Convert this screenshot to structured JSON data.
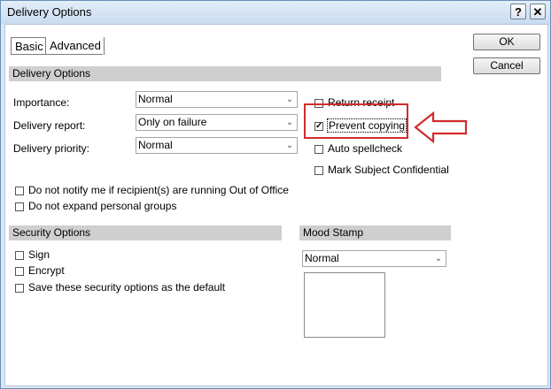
{
  "window": {
    "title": "Delivery Options",
    "help_glyph": "?",
    "close_glyph": "✕"
  },
  "tabs": [
    {
      "label": "Basic"
    },
    {
      "label": "Advanced"
    }
  ],
  "buttons": {
    "ok": "OK",
    "cancel": "Cancel"
  },
  "delivery": {
    "header": "Delivery Options",
    "importance": {
      "label": "Importance:",
      "value": "Normal"
    },
    "report": {
      "label": "Delivery report:",
      "value": "Only on failure"
    },
    "priority": {
      "label": "Delivery priority:",
      "value": "Normal"
    },
    "checkboxes": [
      {
        "label": "Return receipt",
        "checked": false
      },
      {
        "label": "Prevent copying",
        "checked": true
      },
      {
        "label": "Auto spellcheck",
        "checked": false
      },
      {
        "label": "Mark Subject Confidential",
        "checked": false
      }
    ],
    "options": [
      {
        "label": "Do not notify me if recipient(s) are running Out of Office",
        "checked": false
      },
      {
        "label": "Do not expand personal groups",
        "checked": false
      }
    ]
  },
  "security": {
    "header": "Security Options",
    "checkboxes": [
      {
        "label": "Sign",
        "checked": false
      },
      {
        "label": "Encrypt",
        "checked": false
      },
      {
        "label": "Save these security options as the default",
        "checked": false
      }
    ]
  },
  "mood": {
    "header": "Mood Stamp",
    "value": "Normal"
  },
  "glyphs": {
    "check": "✓",
    "chevron": "⌄"
  },
  "annotation": {
    "color": "#d22b2b"
  }
}
